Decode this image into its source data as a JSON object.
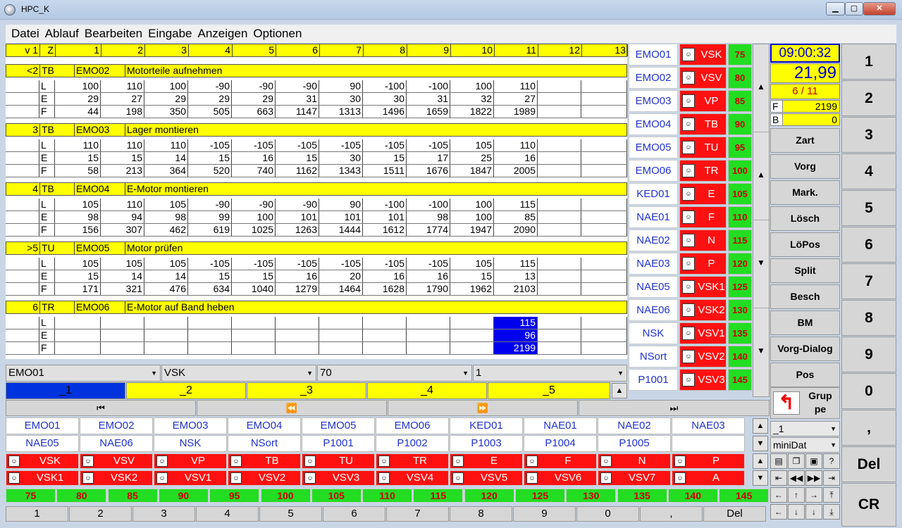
{
  "window": {
    "title": "HPC_K",
    "minimize": "▁",
    "maximize": "▢",
    "close": "✕"
  },
  "menu": [
    "Datei",
    "Ablauf",
    "Bearbeiten",
    "Eingabe",
    "Anzeigen",
    "Optionen"
  ],
  "grid": {
    "header": [
      "v 1",
      "Z",
      "1",
      "2",
      "3",
      "4",
      "5",
      "6",
      "7",
      "8",
      "9",
      "10",
      "11",
      "12",
      "13"
    ],
    "groups": [
      {
        "n": "<2",
        "z": "TB",
        "code": "EMO02",
        "desc": "Motorteile aufnehmen",
        "rows": [
          [
            "L",
            "100",
            "110",
            "100",
            "-90",
            "-90",
            "-90",
            "90",
            "-100",
            "-100",
            "100",
            "110",
            "",
            ""
          ],
          [
            "E",
            "29",
            "27",
            "29",
            "29",
            "29",
            "31",
            "30",
            "30",
            "31",
            "32",
            "27",
            "",
            ""
          ],
          [
            "F",
            "44",
            "198",
            "350",
            "505",
            "663",
            "1147",
            "1313",
            "1496",
            "1659",
            "1822",
            "1989",
            "",
            ""
          ]
        ]
      },
      {
        "n": "3",
        "z": "TB",
        "code": "EMO03",
        "desc": "Lager montieren",
        "rows": [
          [
            "L",
            "110",
            "110",
            "110",
            "-105",
            "-105",
            "-105",
            "-105",
            "-105",
            "-105",
            "105",
            "110",
            "",
            ""
          ],
          [
            "E",
            "15",
            "15",
            "14",
            "15",
            "16",
            "15",
            "30",
            "15",
            "17",
            "25",
            "16",
            "",
            ""
          ],
          [
            "F",
            "58",
            "213",
            "364",
            "520",
            "740",
            "1162",
            "1343",
            "1511",
            "1676",
            "1847",
            "2005",
            "",
            ""
          ]
        ]
      },
      {
        "n": "4",
        "z": "TB",
        "code": "EMO04",
        "desc": "E-Motor montieren",
        "rows": [
          [
            "L",
            "105",
            "110",
            "105",
            "-90",
            "-90",
            "-90",
            "90",
            "-100",
            "-100",
            "100",
            "115",
            "",
            ""
          ],
          [
            "E",
            "98",
            "94",
            "98",
            "99",
            "100",
            "101",
            "101",
            "101",
            "98",
            "100",
            "85",
            "",
            ""
          ],
          [
            "F",
            "156",
            "307",
            "462",
            "619",
            "1025",
            "1263",
            "1444",
            "1612",
            "1774",
            "1947",
            "2090",
            "",
            ""
          ]
        ]
      },
      {
        "n": ">5",
        "z": "TU",
        "code": "EMO05",
        "desc": "Motor prüfen",
        "rows": [
          [
            "L",
            "105",
            "105",
            "105",
            "-105",
            "-105",
            "-105",
            "-105",
            "-105",
            "-105",
            "105",
            "115",
            "",
            ""
          ],
          [
            "E",
            "15",
            "14",
            "14",
            "15",
            "15",
            "16",
            "20",
            "16",
            "16",
            "15",
            "13",
            "",
            ""
          ],
          [
            "F",
            "171",
            "321",
            "476",
            "634",
            "1040",
            "1279",
            "1464",
            "1628",
            "1790",
            "1962",
            "2103",
            "",
            ""
          ]
        ]
      },
      {
        "n": "6",
        "z": "TR",
        "code": "EMO06",
        "desc": "E-Motor auf Band heben",
        "rows": [
          [
            "L",
            "",
            "",
            "",
            "",
            "",
            "",
            "",
            "",
            "",
            "",
            "115",
            "",
            ""
          ],
          [
            "E",
            "",
            "",
            "",
            "",
            "",
            "",
            "",
            "",
            "",
            "",
            "96",
            "",
            ""
          ],
          [
            "F",
            "",
            "",
            "",
            "",
            "",
            "",
            "",
            "",
            "",
            "",
            "2199",
            "",
            ""
          ]
        ]
      }
    ]
  },
  "selects": [
    "EMO01",
    "VSK",
    "70",
    "1"
  ],
  "tabs": [
    "_1",
    "_2",
    "_3",
    "_4",
    "_5"
  ],
  "nav": [
    "⏮",
    "⏪",
    "⏩",
    "⏭"
  ],
  "right_list": [
    {
      "name": "EMO01",
      "code": "VSK",
      "num": "75"
    },
    {
      "name": "EMO02",
      "code": "VSV",
      "num": "80"
    },
    {
      "name": "EMO03",
      "code": "VP",
      "num": "85"
    },
    {
      "name": "EMO04",
      "code": "TB",
      "num": "90"
    },
    {
      "name": "EMO05",
      "code": "TU",
      "num": "95"
    },
    {
      "name": "EMO06",
      "code": "TR",
      "num": "100"
    },
    {
      "name": "KED01",
      "code": "E",
      "num": "105"
    },
    {
      "name": "NAE01",
      "code": "F",
      "num": "110"
    },
    {
      "name": "NAE02",
      "code": "N",
      "num": "115"
    },
    {
      "name": "NAE03",
      "code": "P",
      "num": "120"
    },
    {
      "name": "NAE05",
      "code": "VSK1",
      "num": "125"
    },
    {
      "name": "NAE06",
      "code": "VSK2",
      "num": "130"
    },
    {
      "name": "NSK",
      "code": "VSV1",
      "num": "135"
    },
    {
      "name": "NSort",
      "code": "VSV2",
      "num": "140"
    },
    {
      "name": "P1001",
      "code": "VSV3",
      "num": "145"
    }
  ],
  "info": {
    "time": "09:00:32",
    "value": "21,99",
    "fraction": "6 / 11",
    "f_label": "F",
    "f_value": "2199",
    "b_label": "B",
    "b_value": "0"
  },
  "functions": [
    "Zart",
    "Vorg",
    "Mark.",
    "Lösch",
    "LöPos",
    "Split",
    "Besch",
    "BM",
    "Vorg-Dialog",
    "Pos"
  ],
  "grup": {
    "label": "Grup pe",
    "arrow": "↰"
  },
  "dropdowns": [
    "_1",
    "miniDat"
  ],
  "keypad": [
    "1",
    "2",
    "3",
    "4",
    "5",
    "6",
    "7",
    "8",
    "9",
    "0",
    ",",
    "Del",
    "CR"
  ],
  "bottom": {
    "names1": [
      "EMO01",
      "EMO02",
      "EMO03",
      "EMO04",
      "EMO05",
      "EMO06",
      "KED01",
      "NAE01",
      "NAE02",
      "NAE03"
    ],
    "names2": [
      "NAE05",
      "NAE06",
      "NSK",
      "NSort",
      "P1001",
      "P1002",
      "P1003",
      "P1004",
      "P1005",
      ""
    ],
    "codes1": [
      "VSK",
      "VSV",
      "VP",
      "TB",
      "TU",
      "TR",
      "E",
      "F",
      "N",
      "P"
    ],
    "codes2": [
      "VSK1",
      "VSK2",
      "VSV1",
      "VSV2",
      "VSV3",
      "VSV4",
      "VSV5",
      "VSV6",
      "VSV7",
      "A"
    ],
    "nums": [
      "75",
      "80",
      "85",
      "90",
      "95",
      "100",
      "105",
      "110",
      "115",
      "120",
      "125",
      "130",
      "135",
      "140",
      "145"
    ],
    "digits": [
      "1",
      "2",
      "3",
      "4",
      "5",
      "6",
      "7",
      "8",
      "9",
      "0",
      ",",
      "Del"
    ]
  },
  "icons": {
    "scroll_up": "▲",
    "scroll_down": "▼",
    "dropdown": "▼"
  },
  "colors": {
    "yellow": "#ffff00",
    "red": "#ff1111",
    "green": "#22dd22",
    "blue": "#0000ee"
  }
}
